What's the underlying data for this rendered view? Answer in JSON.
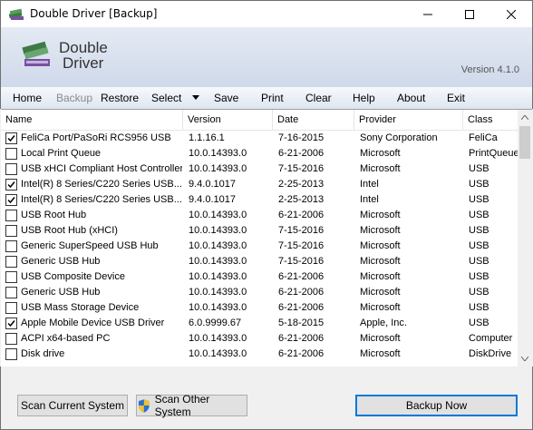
{
  "window": {
    "title": "Double Driver [Backup]"
  },
  "header": {
    "logo_line1": "Double",
    "logo_line2": "Driver",
    "version": "Version 4.1.0"
  },
  "menu": {
    "home": "Home",
    "backup": "Backup",
    "restore": "Restore",
    "select": "Select",
    "save": "Save",
    "print": "Print",
    "clear": "Clear",
    "help": "Help",
    "about": "About",
    "exit": "Exit"
  },
  "columns": {
    "name": "Name",
    "version": "Version",
    "date": "Date",
    "provider": "Provider",
    "class": "Class"
  },
  "rows": [
    {
      "checked": true,
      "name": "FeliCa Port/PaSoRi RCS956 USB",
      "version": "1.1.16.1",
      "date": "7-16-2015",
      "provider": "Sony Corporation",
      "class": "FeliCa"
    },
    {
      "checked": false,
      "name": "Local Print Queue",
      "version": "10.0.14393.0",
      "date": "6-21-2006",
      "provider": "Microsoft",
      "class": "PrintQueue"
    },
    {
      "checked": false,
      "name": "USB xHCI Compliant Host Controller",
      "version": "10.0.14393.0",
      "date": "7-15-2016",
      "provider": "Microsoft",
      "class": "USB"
    },
    {
      "checked": true,
      "name": "Intel(R) 8 Series/C220 Series USB...",
      "version": "9.4.0.1017",
      "date": "2-25-2013",
      "provider": "Intel",
      "class": "USB"
    },
    {
      "checked": true,
      "name": "Intel(R) 8 Series/C220 Series USB...",
      "version": "9.4.0.1017",
      "date": "2-25-2013",
      "provider": "Intel",
      "class": "USB"
    },
    {
      "checked": false,
      "name": "USB Root Hub",
      "version": "10.0.14393.0",
      "date": "6-21-2006",
      "provider": "Microsoft",
      "class": "USB"
    },
    {
      "checked": false,
      "name": "USB Root Hub (xHCI)",
      "version": "10.0.14393.0",
      "date": "7-15-2016",
      "provider": "Microsoft",
      "class": "USB"
    },
    {
      "checked": false,
      "name": "Generic SuperSpeed USB Hub",
      "version": "10.0.14393.0",
      "date": "7-15-2016",
      "provider": "Microsoft",
      "class": "USB"
    },
    {
      "checked": false,
      "name": "Generic USB Hub",
      "version": "10.0.14393.0",
      "date": "7-15-2016",
      "provider": "Microsoft",
      "class": "USB"
    },
    {
      "checked": false,
      "name": "USB Composite Device",
      "version": "10.0.14393.0",
      "date": "6-21-2006",
      "provider": "Microsoft",
      "class": "USB"
    },
    {
      "checked": false,
      "name": "Generic USB Hub",
      "version": "10.0.14393.0",
      "date": "6-21-2006",
      "provider": "Microsoft",
      "class": "USB"
    },
    {
      "checked": false,
      "name": "USB Mass Storage Device",
      "version": "10.0.14393.0",
      "date": "6-21-2006",
      "provider": "Microsoft",
      "class": "USB"
    },
    {
      "checked": true,
      "name": "Apple Mobile Device USB Driver",
      "version": "6.0.9999.67",
      "date": "5-18-2015",
      "provider": "Apple, Inc.",
      "class": "USB"
    },
    {
      "checked": false,
      "name": "ACPI x64-based PC",
      "version": "10.0.14393.0",
      "date": "6-21-2006",
      "provider": "Microsoft",
      "class": "Computer"
    },
    {
      "checked": false,
      "name": "Disk drive",
      "version": "10.0.14393.0",
      "date": "6-21-2006",
      "provider": "Microsoft",
      "class": "DiskDrive"
    }
  ],
  "footer": {
    "scan_current": "Scan Current System",
    "scan_other": "Scan Other System",
    "backup_now": "Backup Now"
  },
  "colors": {
    "accent": "#0078d7",
    "header_bg": "#d6dfee"
  }
}
